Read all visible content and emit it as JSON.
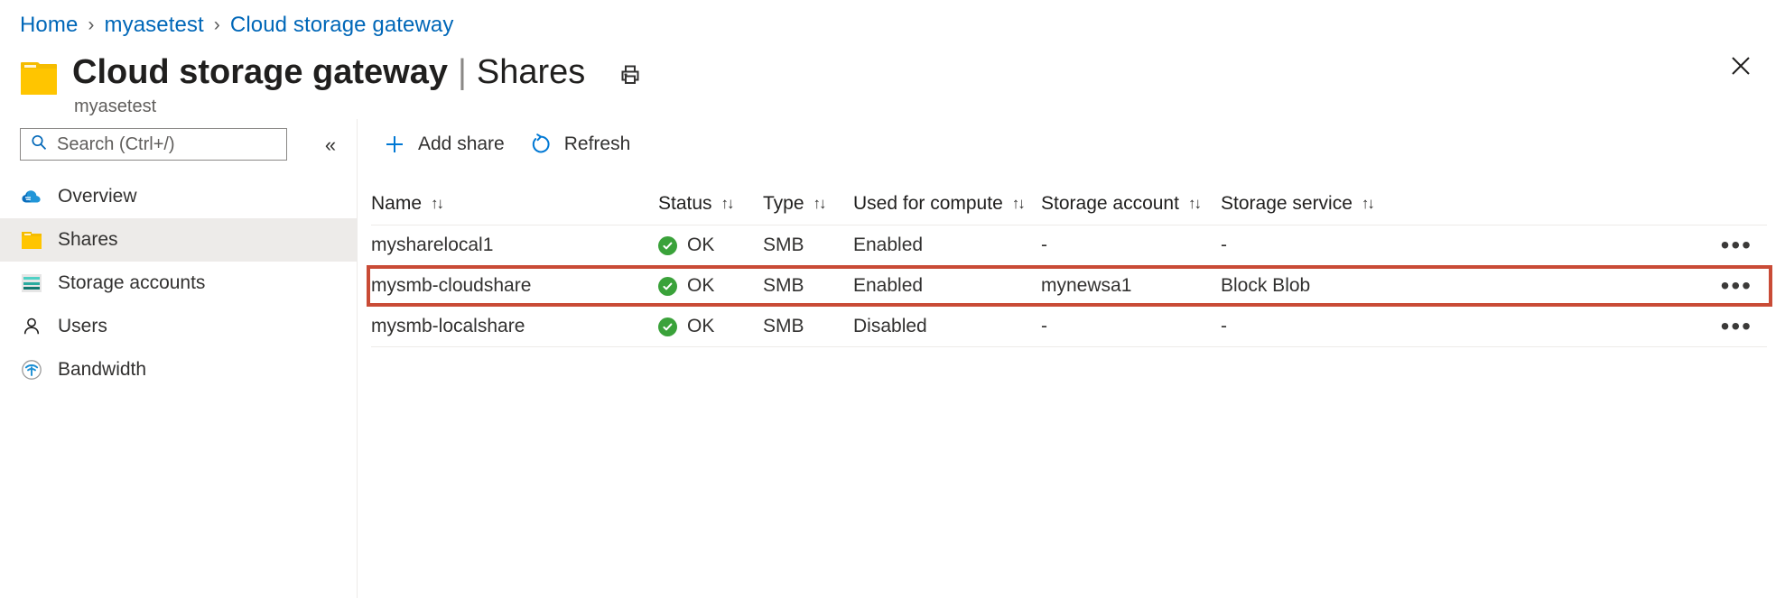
{
  "breadcrumb": {
    "items": [
      {
        "label": "Home"
      },
      {
        "label": "myasetest"
      },
      {
        "label": "Cloud storage gateway"
      }
    ],
    "separator": "›"
  },
  "header": {
    "title": "Cloud storage gateway",
    "title_separator": "|",
    "title_section": "Shares",
    "subtitle": "myasetest",
    "print_icon": "printer-icon",
    "close_icon": "close-icon",
    "resource_icon": "folder-icon"
  },
  "sidebar": {
    "search": {
      "placeholder": "Search (Ctrl+/)",
      "value": "",
      "icon": "search-icon"
    },
    "collapse_label": "«",
    "items": [
      {
        "label": "Overview",
        "icon": "cloud-icon",
        "selected": false
      },
      {
        "label": "Shares",
        "icon": "folder-icon",
        "selected": true
      },
      {
        "label": "Storage accounts",
        "icon": "storage-stack-icon",
        "selected": false
      },
      {
        "label": "Users",
        "icon": "person-icon",
        "selected": false
      },
      {
        "label": "Bandwidth",
        "icon": "wifi-icon",
        "selected": false
      }
    ]
  },
  "toolbar": {
    "add_share_label": "Add share",
    "add_share_icon": "plus-icon",
    "refresh_label": "Refresh",
    "refresh_icon": "refresh-icon"
  },
  "table": {
    "sort_indicator": "↑↓",
    "columns": [
      {
        "label": "Name"
      },
      {
        "label": "Status"
      },
      {
        "label": "Type"
      },
      {
        "label": "Used for compute"
      },
      {
        "label": "Storage account"
      },
      {
        "label": "Storage service"
      }
    ],
    "row_menu_label": "•••",
    "rows": [
      {
        "name": "mysharelocal1",
        "status": "OK",
        "status_icon": "check-circle-icon",
        "type": "SMB",
        "used_for_compute": "Enabled",
        "storage_account": "-",
        "storage_service": "-",
        "highlighted": false
      },
      {
        "name": "mysmb-cloudshare",
        "status": "OK",
        "status_icon": "check-circle-icon",
        "type": "SMB",
        "used_for_compute": "Enabled",
        "storage_account": "mynewsa1",
        "storage_service": "Block Blob",
        "highlighted": true
      },
      {
        "name": "mysmb-localshare",
        "status": "OK",
        "status_icon": "check-circle-icon",
        "type": "SMB",
        "used_for_compute": "Disabled",
        "storage_account": "-",
        "storage_service": "-",
        "highlighted": false
      }
    ]
  },
  "colors": {
    "link": "#0067b8",
    "accent": "#0078d4",
    "status_ok": "#3aa23a",
    "highlight_border": "#c94b36",
    "folder": "#ffc500",
    "selected_row": "#edebe9"
  }
}
